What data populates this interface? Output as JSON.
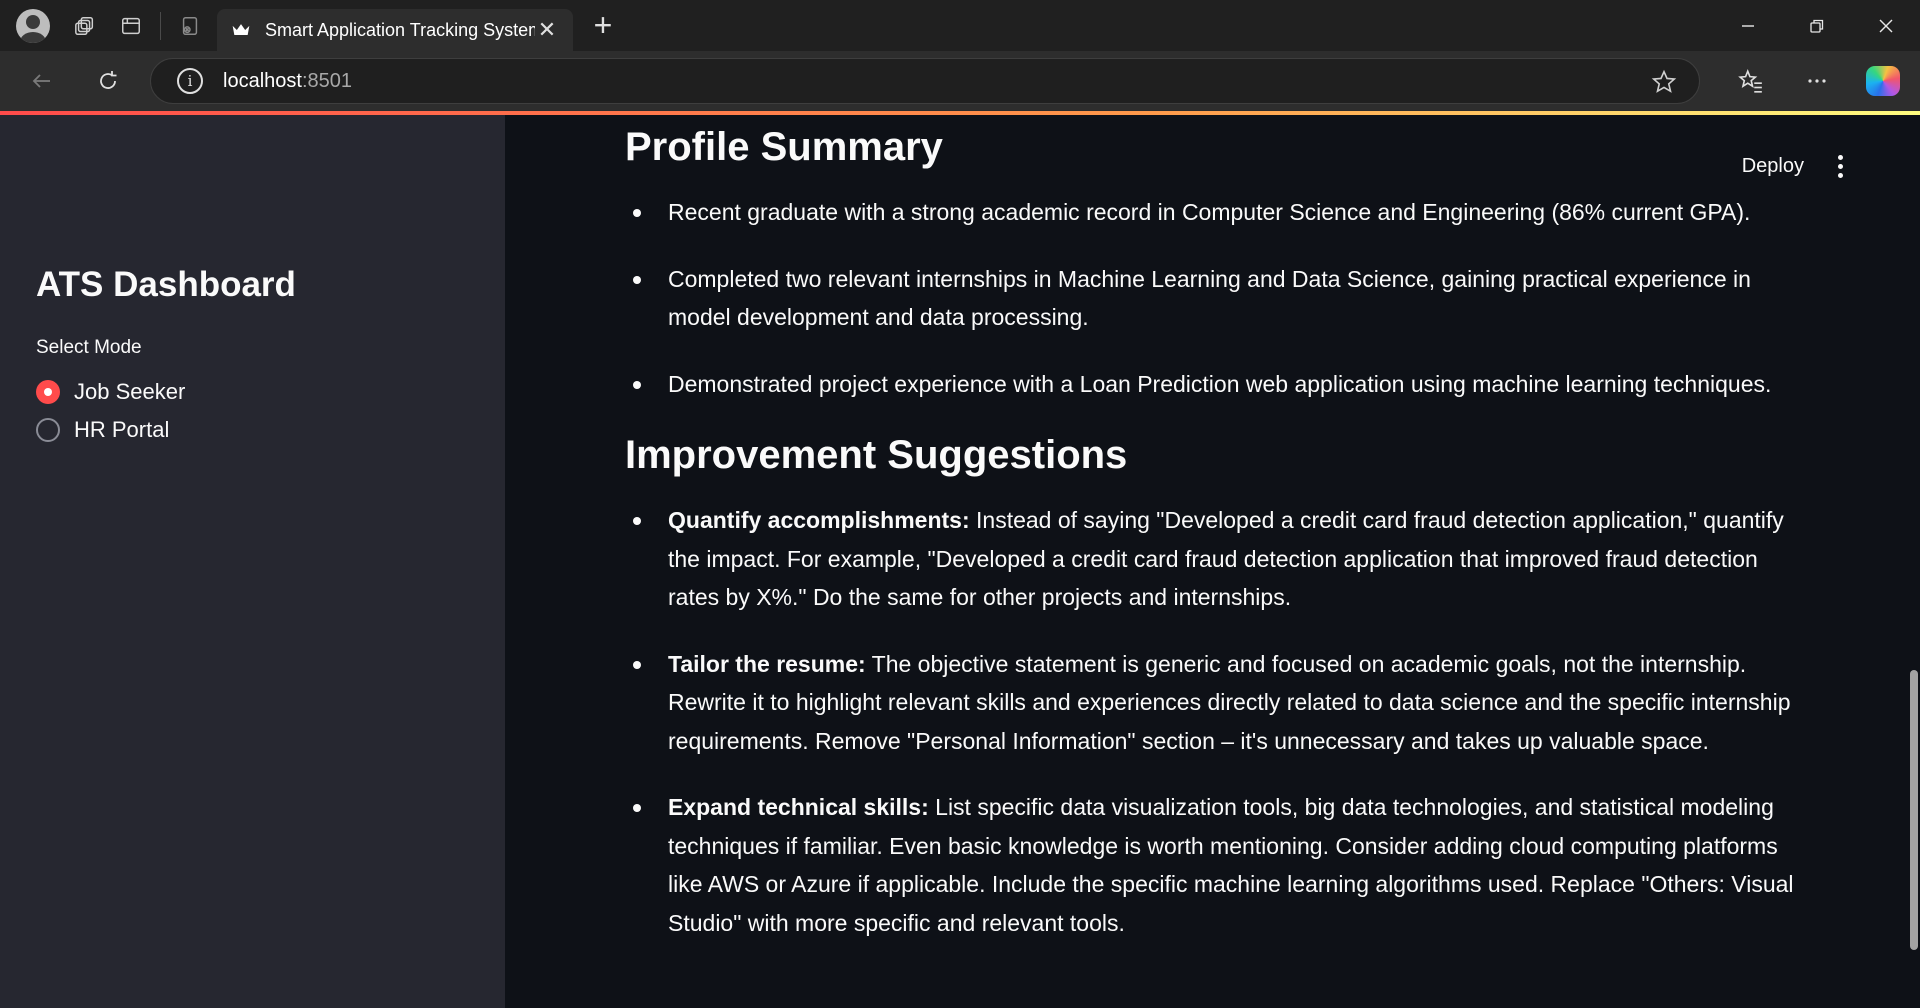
{
  "browser": {
    "tab_title": "Smart Application Tracking System",
    "url_host": "localhost",
    "url_port": ":8501",
    "new_tab_symbol": "+",
    "close_symbol": "✕"
  },
  "sidebar": {
    "title": "ATS Dashboard",
    "mode_label": "Select Mode",
    "options": [
      {
        "label": "Job Seeker",
        "selected": true
      },
      {
        "label": "HR Portal",
        "selected": false
      }
    ]
  },
  "header": {
    "deploy_label": "Deploy"
  },
  "profile": {
    "heading": "Profile Summary",
    "items": [
      "Recent graduate with a strong academic record in Computer Science and Engineering (86% current GPA).",
      "Completed two relevant internships in Machine Learning and Data Science, gaining practical experience in model development and data processing.",
      "Demonstrated project experience with a Loan Prediction web application using machine learning techniques."
    ]
  },
  "improvements": {
    "heading": "Improvement Suggestions",
    "items": [
      {
        "title": "Quantify accomplishments:",
        "text": " Instead of saying \"Developed a credit card fraud detection application,\" quantify the impact. For example, \"Developed a credit card fraud detection application that improved fraud detection rates by X%.\" Do the same for other projects and internships."
      },
      {
        "title": "Tailor the resume:",
        "text": " The objective statement is generic and focused on academic goals, not the internship. Rewrite it to highlight relevant skills and experiences directly related to data science and the specific internship requirements. Remove \"Personal Information\" section – it's unnecessary and takes up valuable space."
      },
      {
        "title": "Expand technical skills:",
        "text": " List specific data visualization tools, big data technologies, and statistical modeling techniques if familiar. Even basic knowledge is worth mentioning. Consider adding cloud computing platforms like AWS or Azure if applicable. Include the specific machine learning algorithms used. Replace \"Others: Visual Studio\" with more specific and relevant tools."
      }
    ]
  },
  "colors": {
    "accent": "#ff4b4b",
    "sidebar_bg": "#262730",
    "main_bg": "#0e1117"
  }
}
